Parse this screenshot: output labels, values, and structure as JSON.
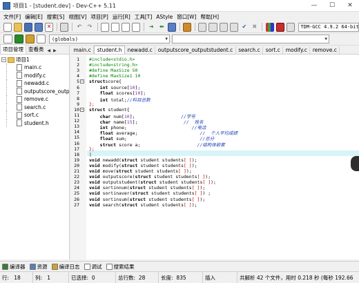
{
  "window": {
    "title": "项目1 - [student.dev] - Dev-C++ 5.11",
    "min": "—",
    "max": "☐",
    "close": "✕"
  },
  "menu": [
    "文件[F]",
    "编辑[E]",
    "搜索[S]",
    "视图[V]",
    "项目[P]",
    "运行[R]",
    "工具[T]",
    "AStyle",
    "窗口[W]",
    "帮助[H]"
  ],
  "toolbar": {
    "compiler": "TDM-GCC 4.9.2 64-bit",
    "globals": "(globals)"
  },
  "left_panel": {
    "tabs": [
      "项目管理",
      "查看类"
    ],
    "nav_prev": "◀",
    "nav_next": "▶",
    "project": "项目1",
    "files": [
      "main.c",
      "modify.c",
      "newadd.c",
      "outputscore_output",
      "remove.c",
      "search.c",
      "sort.c",
      "student.h"
    ]
  },
  "editor": {
    "tabs": [
      "main.c",
      "student.h",
      "newadd.c",
      "outputscore_outputstudent.c",
      "search.c",
      "sort.c",
      "modify.c",
      "remove.c"
    ],
    "active_tab": "student.h",
    "current_line": 18
  },
  "bottom_tabs": [
    "编译器",
    "资源",
    "编译日志",
    "调试",
    "搜索结果"
  ],
  "status": {
    "row_label": "行:",
    "row": "18",
    "col_label": "列:",
    "col": "1",
    "sel_label": "已选择:",
    "sel": "0",
    "lines_label": "总行数:",
    "lines": "28",
    "len_label": "长度:",
    "len": "835",
    "mode": "插入",
    "parse": "共解析 42 个文件，用时 0.218 秒 (每秒 192.66"
  },
  "colors": {
    "preprocessor": "#008000",
    "comment": "#1f3fb5",
    "number": "#7a28b7",
    "current_line_bg": "#d8f4f8"
  }
}
